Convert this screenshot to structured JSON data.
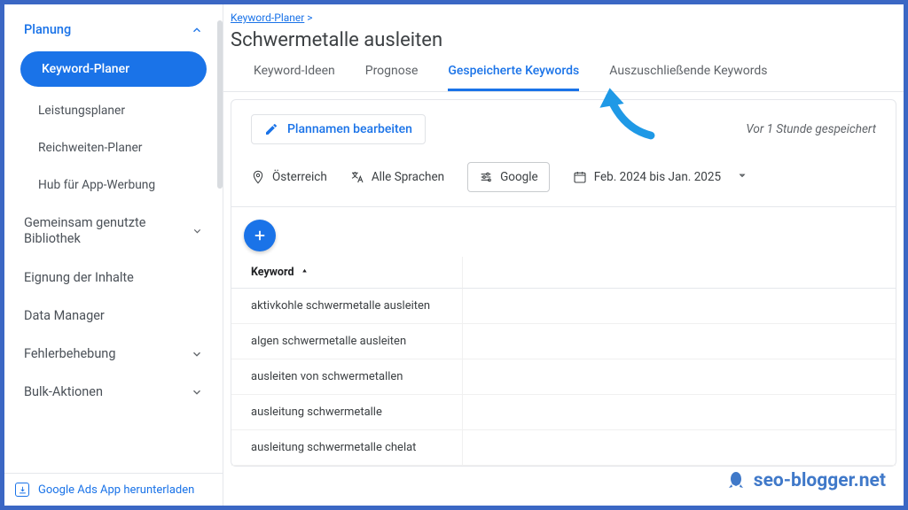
{
  "sidebar": {
    "head": "Planung",
    "active": "Keyword-Planer",
    "subs": [
      "Leistungsplaner",
      "Reichweiten-Planer",
      "Hub für App-Werbung"
    ],
    "items": [
      "Gemeinsam genutzte Bibliothek",
      "Eignung der Inhalte",
      "Data Manager",
      "Fehlerbehebung",
      "Bulk-Aktionen"
    ],
    "footer": "Google Ads App herunterladen"
  },
  "breadcrumb": "Keyword-Planer",
  "title": "Schwermetalle ausleiten",
  "tabs": [
    "Keyword-Ideen",
    "Prognose",
    "Gespeicherte Keywords",
    "Auszuschließende Keywords"
  ],
  "active_tab_index": 2,
  "edit_button": "Plannamen bearbeiten",
  "saved_text": "Vor 1 Stunde gespeichert",
  "filters": {
    "location": "Österreich",
    "language": "Alle Sprachen",
    "network": "Google",
    "date": "Feb. 2024 bis Jan. 2025"
  },
  "table": {
    "header": "Keyword",
    "rows": [
      "aktivkohle schwermetalle ausleiten",
      "algen schwermetalle ausleiten",
      "ausleiten von schwermetallen",
      "ausleitung schwermetalle",
      "ausleitung schwermetalle chelat"
    ]
  },
  "watermark": "seo-blogger.net"
}
